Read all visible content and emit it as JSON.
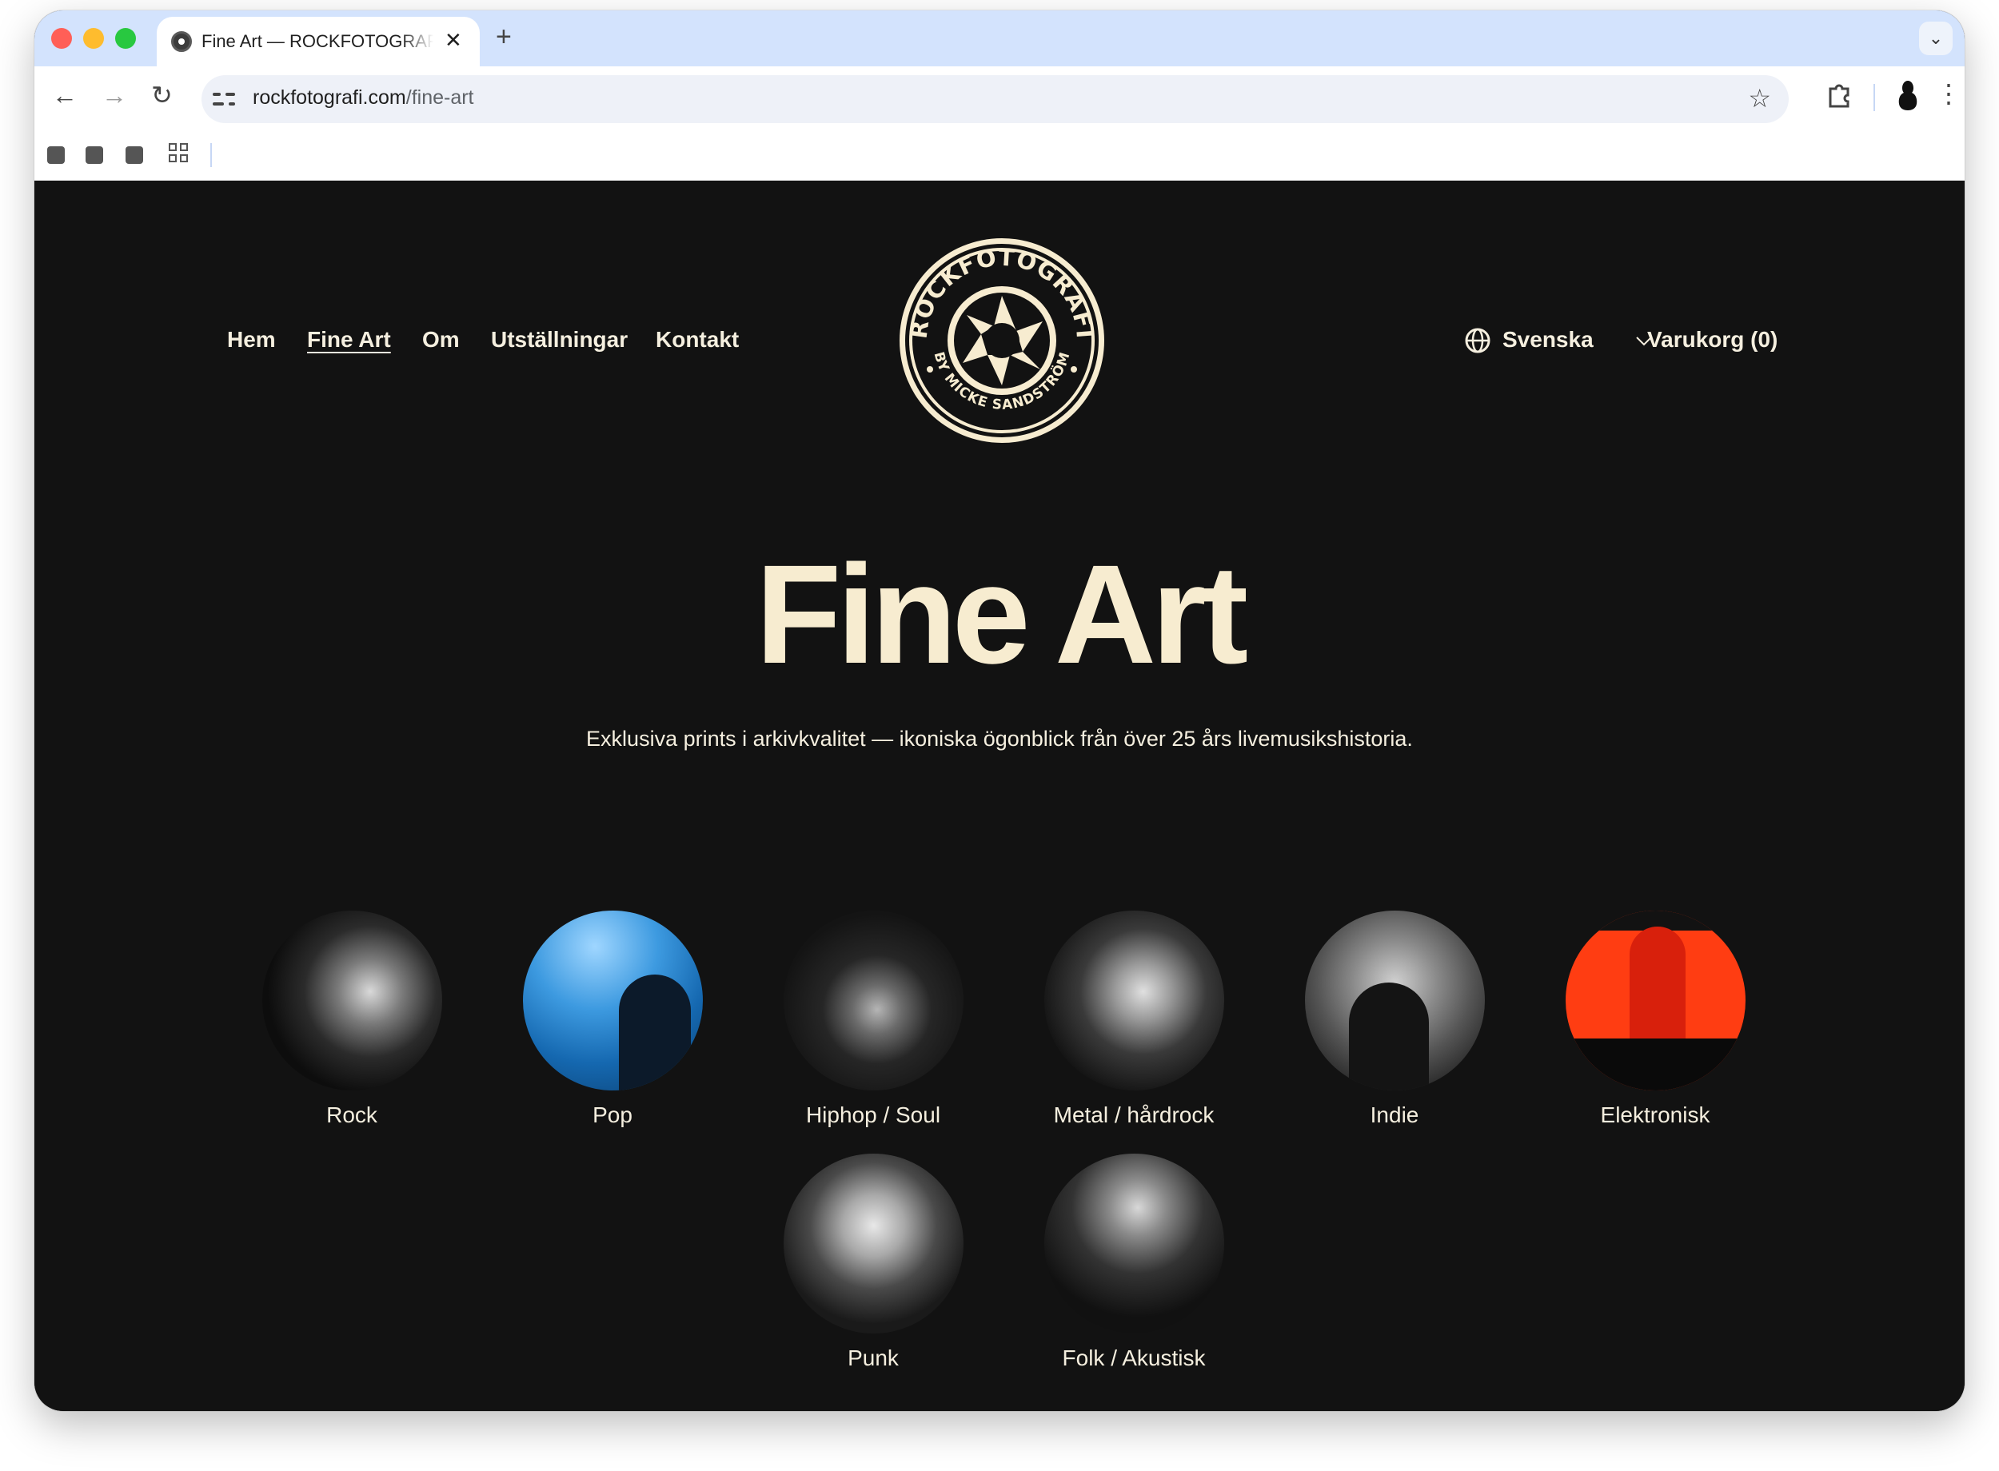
{
  "browser": {
    "tab_title": "Fine Art — ROCKFOTOGRAFI",
    "url_domain": "rockfotografi.com",
    "url_path": "/fine-art"
  },
  "site": {
    "logo": {
      "top_text": "ROCKFOTOGRAFI",
      "bottom_text": "BY MICKE SANDSTRÖM"
    },
    "nav": [
      {
        "label": "Hem",
        "active": false
      },
      {
        "label": "Fine Art",
        "active": true
      },
      {
        "label": "Om",
        "active": false
      },
      {
        "label": "Utställningar",
        "active": false
      },
      {
        "label": "Kontakt",
        "active": false
      }
    ],
    "language": "Svenska",
    "cart": "Varukorg (0)"
  },
  "hero": {
    "title": "Fine Art",
    "subtitle": "Exklusiva prints i arkivkvalitet — ikoniska ögonblick från över 25 års livemusikshistoria."
  },
  "categories": [
    {
      "label": "Rock"
    },
    {
      "label": "Pop"
    },
    {
      "label": "Hiphop / Soul"
    },
    {
      "label": "Metal / hårdrock"
    },
    {
      "label": "Indie"
    },
    {
      "label": "Elektronisk"
    },
    {
      "label": "Punk"
    },
    {
      "label": "Folk / Akustisk"
    }
  ],
  "colors": {
    "page_bg": "#121212",
    "cream": "#f7ecd0",
    "text": "#f5efdf",
    "browser_frame": "#d3e3fd"
  }
}
